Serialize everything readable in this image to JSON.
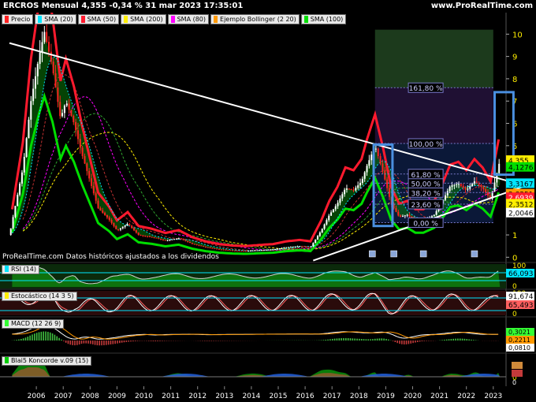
{
  "header": {
    "title": "ERCROS Mensual 4,355 -0,34 % 31 mar 2023 17:35:01",
    "site": "www.ProRealTime.com"
  },
  "legend": [
    {
      "label": "Precio",
      "color": "#ff2020"
    },
    {
      "label": "SMA (20)",
      "color": "#00e5ff"
    },
    {
      "label": "SMA (50)",
      "color": "#ff1a2e"
    },
    {
      "label": "SMA (200)",
      "color": "#ffee00"
    },
    {
      "label": "SMA (80)",
      "color": "#ff00ff"
    },
    {
      "label": "Ejemplo Bollinger (2 20)",
      "color": "#ff9900"
    },
    {
      "label": "SMA (100)",
      "color": "#00dd00"
    }
  ],
  "footnote": "ProRealTime.com Datos históricos ajustados a los dividendos",
  "panels": {
    "rsi": {
      "label": "RSI (14)",
      "color": "#00e5ff"
    },
    "stoch": {
      "label": "Estocástico (14 3 5)",
      "color": "#ffee00"
    },
    "macd": {
      "label": "MACD (12 26 9)",
      "color": "#33ff33"
    },
    "kon": {
      "label": "Blai5 Koncorde v.09 (15)",
      "color": "#00cc00"
    }
  },
  "colors": {
    "price_up": "#ffffff",
    "price_down": "#ff2020",
    "sma20": "#00e5ff",
    "sma50": "#ff1a2e",
    "sma200": "#ffee00",
    "sma80": "#ff00ff",
    "bollinger": "#ff9900",
    "sma100": "#00dd00",
    "fill_up": "#0a7a0a",
    "fill_down": "#6a0a0a",
    "trendline": "#ffffff",
    "box": "#4a8fe0"
  },
  "chart_data": [
    {
      "type": "line",
      "title": "ERCROS Mensual",
      "x_ticks": [
        "2006",
        "2007",
        "2008",
        "2009",
        "2010",
        "2011",
        "2012",
        "2013",
        "2014",
        "2015",
        "2016",
        "2017",
        "2018",
        "2019",
        "2020",
        "2021",
        "2022",
        "2023"
      ],
      "y_ticks": [
        0,
        1,
        2,
        3,
        4,
        5,
        6,
        7,
        8,
        9,
        10
      ],
      "ylim": [
        -0.2,
        10.4
      ],
      "price_points": [
        {
          "x": 2005.0,
          "y": 1.0
        },
        {
          "x": 2005.2,
          "y": 2.2
        },
        {
          "x": 2005.5,
          "y": 4.0
        },
        {
          "x": 2005.8,
          "y": 7.0
        },
        {
          "x": 2006.1,
          "y": 9.0
        },
        {
          "x": 2006.3,
          "y": 10.1
        },
        {
          "x": 2006.6,
          "y": 8.5
        },
        {
          "x": 2006.9,
          "y": 6.2
        },
        {
          "x": 2007.1,
          "y": 7.0
        },
        {
          "x": 2007.4,
          "y": 6.0
        },
        {
          "x": 2007.7,
          "y": 4.6
        },
        {
          "x": 2008.0,
          "y": 3.4
        },
        {
          "x": 2008.3,
          "y": 2.2
        },
        {
          "x": 2008.7,
          "y": 1.7
        },
        {
          "x": 2009.0,
          "y": 1.2
        },
        {
          "x": 2009.4,
          "y": 1.5
        },
        {
          "x": 2009.8,
          "y": 1.0
        },
        {
          "x": 2010.3,
          "y": 0.9
        },
        {
          "x": 2010.8,
          "y": 0.75
        },
        {
          "x": 2011.3,
          "y": 0.85
        },
        {
          "x": 2011.8,
          "y": 0.6
        },
        {
          "x": 2012.3,
          "y": 0.45
        },
        {
          "x": 2012.8,
          "y": 0.35
        },
        {
          "x": 2013.3,
          "y": 0.3
        },
        {
          "x": 2013.8,
          "y": 0.28
        },
        {
          "x": 2014.3,
          "y": 0.32
        },
        {
          "x": 2014.8,
          "y": 0.35
        },
        {
          "x": 2015.3,
          "y": 0.45
        },
        {
          "x": 2015.8,
          "y": 0.5
        },
        {
          "x": 2016.2,
          "y": 0.45
        },
        {
          "x": 2016.6,
          "y": 1.2
        },
        {
          "x": 2016.9,
          "y": 1.9
        },
        {
          "x": 2017.2,
          "y": 2.4
        },
        {
          "x": 2017.5,
          "y": 3.1
        },
        {
          "x": 2017.8,
          "y": 3.0
        },
        {
          "x": 2018.1,
          "y": 3.4
        },
        {
          "x": 2018.3,
          "y": 4.1
        },
        {
          "x": 2018.6,
          "y": 5.0
        },
        {
          "x": 2018.9,
          "y": 3.8
        },
        {
          "x": 2019.2,
          "y": 2.4
        },
        {
          "x": 2019.5,
          "y": 1.8
        },
        {
          "x": 2019.8,
          "y": 1.9
        },
        {
          "x": 2020.1,
          "y": 1.6
        },
        {
          "x": 2020.4,
          "y": 1.6
        },
        {
          "x": 2020.8,
          "y": 1.9
        },
        {
          "x": 2021.1,
          "y": 2.5
        },
        {
          "x": 2021.4,
          "y": 3.2
        },
        {
          "x": 2021.7,
          "y": 3.3
        },
        {
          "x": 2022.0,
          "y": 3.0
        },
        {
          "x": 2022.3,
          "y": 3.4
        },
        {
          "x": 2022.6,
          "y": 3.1
        },
        {
          "x": 2022.9,
          "y": 2.6
        },
        {
          "x": 2023.1,
          "y": 3.6
        },
        {
          "x": 2023.25,
          "y": 4.355
        }
      ],
      "fibonacci_levels": [
        {
          "label": "0,00 %",
          "y": 1.55
        },
        {
          "label": "23,60 %",
          "y": 2.38
        },
        {
          "label": "38,20 %",
          "y": 2.9
        },
        {
          "label": "50,00 %",
          "y": 3.32
        },
        {
          "label": "61,80 %",
          "y": 3.73
        },
        {
          "label": "100,00 %",
          "y": 5.1
        },
        {
          "label": "161,80 %",
          "y": 7.6
        }
      ],
      "price_labels": [
        {
          "text": "4,355",
          "y": 4.355,
          "bg": "#ffee00",
          "fg": "#000000"
        },
        {
          "text": "4,1276",
          "y": 4.05,
          "bg": "#00dd00",
          "fg": "#000000"
        },
        {
          "text": "3,3167",
          "y": 3.32,
          "bg": "#00e5ff",
          "fg": "#000000"
        },
        {
          "text": "2,8251",
          "y": 2.85,
          "bg": "#ff9900",
          "fg": "#000000"
        },
        {
          "text": "2,6939",
          "y": 2.69,
          "bg": "#ff1a2e",
          "fg": "#ffffff"
        },
        {
          "text": "2,3512",
          "y": 2.4,
          "bg": "#ffee00",
          "fg": "#000000"
        },
        {
          "text": "2,0046",
          "y": 2.0,
          "bg": "#ffffff",
          "fg": "#000000"
        }
      ]
    },
    {
      "type": "line",
      "title": "RSI (14)",
      "y_ticks": [
        0,
        100
      ],
      "ylim": [
        0,
        100
      ],
      "last_value_label": "66,093"
    },
    {
      "type": "line",
      "title": "Estocástico (14 3 5)",
      "y_ticks": [
        0,
        100
      ],
      "ylim": [
        0,
        100
      ],
      "last_value_labels": [
        "91,674",
        "65,493"
      ]
    },
    {
      "type": "bar",
      "title": "MACD (12 26 9)",
      "last_value_labels": [
        "0,3021",
        "0,2211",
        "0,0810"
      ]
    },
    {
      "type": "area",
      "title": "Blai5 Koncorde v.09 (15)",
      "y_ticks": [
        0
      ],
      "last_value_labels": [
        "0"
      ]
    }
  ]
}
